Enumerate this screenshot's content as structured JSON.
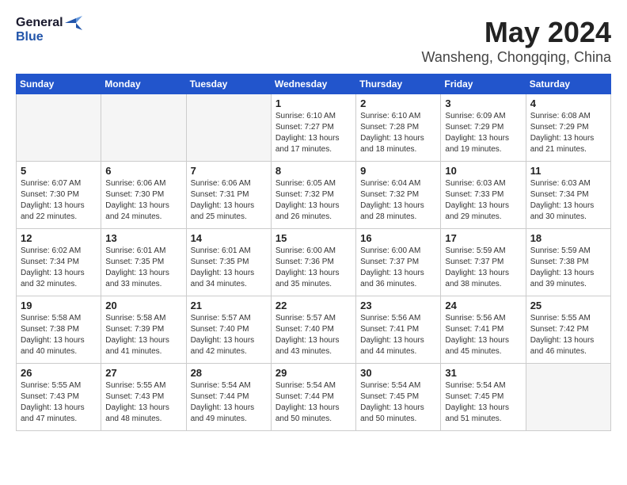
{
  "header": {
    "logo_line1": "General",
    "logo_line2": "Blue",
    "month": "May 2024",
    "location": "Wansheng, Chongqing, China"
  },
  "weekdays": [
    "Sunday",
    "Monday",
    "Tuesday",
    "Wednesday",
    "Thursday",
    "Friday",
    "Saturday"
  ],
  "weeks": [
    [
      {
        "day": "",
        "info": "",
        "empty": true
      },
      {
        "day": "",
        "info": "",
        "empty": true
      },
      {
        "day": "",
        "info": "",
        "empty": true
      },
      {
        "day": "1",
        "info": "Sunrise: 6:10 AM\nSunset: 7:27 PM\nDaylight: 13 hours\nand 17 minutes."
      },
      {
        "day": "2",
        "info": "Sunrise: 6:10 AM\nSunset: 7:28 PM\nDaylight: 13 hours\nand 18 minutes."
      },
      {
        "day": "3",
        "info": "Sunrise: 6:09 AM\nSunset: 7:29 PM\nDaylight: 13 hours\nand 19 minutes."
      },
      {
        "day": "4",
        "info": "Sunrise: 6:08 AM\nSunset: 7:29 PM\nDaylight: 13 hours\nand 21 minutes."
      }
    ],
    [
      {
        "day": "5",
        "info": "Sunrise: 6:07 AM\nSunset: 7:30 PM\nDaylight: 13 hours\nand 22 minutes."
      },
      {
        "day": "6",
        "info": "Sunrise: 6:06 AM\nSunset: 7:30 PM\nDaylight: 13 hours\nand 24 minutes."
      },
      {
        "day": "7",
        "info": "Sunrise: 6:06 AM\nSunset: 7:31 PM\nDaylight: 13 hours\nand 25 minutes."
      },
      {
        "day": "8",
        "info": "Sunrise: 6:05 AM\nSunset: 7:32 PM\nDaylight: 13 hours\nand 26 minutes."
      },
      {
        "day": "9",
        "info": "Sunrise: 6:04 AM\nSunset: 7:32 PM\nDaylight: 13 hours\nand 28 minutes."
      },
      {
        "day": "10",
        "info": "Sunrise: 6:03 AM\nSunset: 7:33 PM\nDaylight: 13 hours\nand 29 minutes."
      },
      {
        "day": "11",
        "info": "Sunrise: 6:03 AM\nSunset: 7:34 PM\nDaylight: 13 hours\nand 30 minutes."
      }
    ],
    [
      {
        "day": "12",
        "info": "Sunrise: 6:02 AM\nSunset: 7:34 PM\nDaylight: 13 hours\nand 32 minutes."
      },
      {
        "day": "13",
        "info": "Sunrise: 6:01 AM\nSunset: 7:35 PM\nDaylight: 13 hours\nand 33 minutes."
      },
      {
        "day": "14",
        "info": "Sunrise: 6:01 AM\nSunset: 7:35 PM\nDaylight: 13 hours\nand 34 minutes."
      },
      {
        "day": "15",
        "info": "Sunrise: 6:00 AM\nSunset: 7:36 PM\nDaylight: 13 hours\nand 35 minutes."
      },
      {
        "day": "16",
        "info": "Sunrise: 6:00 AM\nSunset: 7:37 PM\nDaylight: 13 hours\nand 36 minutes."
      },
      {
        "day": "17",
        "info": "Sunrise: 5:59 AM\nSunset: 7:37 PM\nDaylight: 13 hours\nand 38 minutes."
      },
      {
        "day": "18",
        "info": "Sunrise: 5:59 AM\nSunset: 7:38 PM\nDaylight: 13 hours\nand 39 minutes."
      }
    ],
    [
      {
        "day": "19",
        "info": "Sunrise: 5:58 AM\nSunset: 7:38 PM\nDaylight: 13 hours\nand 40 minutes."
      },
      {
        "day": "20",
        "info": "Sunrise: 5:58 AM\nSunset: 7:39 PM\nDaylight: 13 hours\nand 41 minutes."
      },
      {
        "day": "21",
        "info": "Sunrise: 5:57 AM\nSunset: 7:40 PM\nDaylight: 13 hours\nand 42 minutes."
      },
      {
        "day": "22",
        "info": "Sunrise: 5:57 AM\nSunset: 7:40 PM\nDaylight: 13 hours\nand 43 minutes."
      },
      {
        "day": "23",
        "info": "Sunrise: 5:56 AM\nSunset: 7:41 PM\nDaylight: 13 hours\nand 44 minutes."
      },
      {
        "day": "24",
        "info": "Sunrise: 5:56 AM\nSunset: 7:41 PM\nDaylight: 13 hours\nand 45 minutes."
      },
      {
        "day": "25",
        "info": "Sunrise: 5:55 AM\nSunset: 7:42 PM\nDaylight: 13 hours\nand 46 minutes."
      }
    ],
    [
      {
        "day": "26",
        "info": "Sunrise: 5:55 AM\nSunset: 7:43 PM\nDaylight: 13 hours\nand 47 minutes."
      },
      {
        "day": "27",
        "info": "Sunrise: 5:55 AM\nSunset: 7:43 PM\nDaylight: 13 hours\nand 48 minutes."
      },
      {
        "day": "28",
        "info": "Sunrise: 5:54 AM\nSunset: 7:44 PM\nDaylight: 13 hours\nand 49 minutes."
      },
      {
        "day": "29",
        "info": "Sunrise: 5:54 AM\nSunset: 7:44 PM\nDaylight: 13 hours\nand 50 minutes."
      },
      {
        "day": "30",
        "info": "Sunrise: 5:54 AM\nSunset: 7:45 PM\nDaylight: 13 hours\nand 50 minutes."
      },
      {
        "day": "31",
        "info": "Sunrise: 5:54 AM\nSunset: 7:45 PM\nDaylight: 13 hours\nand 51 minutes."
      },
      {
        "day": "",
        "info": "",
        "empty": true
      }
    ]
  ]
}
